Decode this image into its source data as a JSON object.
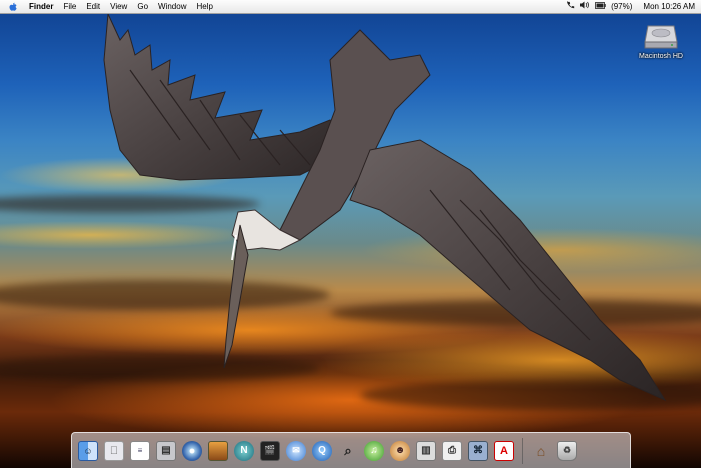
{
  "menubar": {
    "app_name": "Finder",
    "items": [
      "File",
      "Edit",
      "View",
      "Go",
      "Window",
      "Help"
    ],
    "battery": "(97%)",
    "clock": "Mon 10:26 AM"
  },
  "desktop": {
    "hd_label": "Macintosh HD"
  },
  "dock": {
    "items": [
      {
        "name": "finder",
        "icon": "finder-icon"
      },
      {
        "name": "about-mac",
        "icon": "apple-icon"
      },
      {
        "name": "text-edit",
        "icon": "document-icon"
      },
      {
        "name": "printer",
        "icon": "printer-icon"
      },
      {
        "name": "itunes-cd",
        "icon": "cd-icon"
      },
      {
        "name": "iphoto",
        "icon": "photo-icon"
      },
      {
        "name": "internet-connect",
        "icon": "n-icon"
      },
      {
        "name": "imovie",
        "icon": "clapper-icon"
      },
      {
        "name": "mail",
        "icon": "mail-icon"
      },
      {
        "name": "quicktime",
        "icon": "quicktime-icon"
      },
      {
        "name": "sherlock",
        "icon": "magnifier-icon"
      },
      {
        "name": "itunes",
        "icon": "music-icon"
      },
      {
        "name": "ichat",
        "icon": "face-icon"
      },
      {
        "name": "print-center",
        "icon": "print-center-icon"
      },
      {
        "name": "fax",
        "icon": "fax-icon"
      },
      {
        "name": "network",
        "icon": "network-icon"
      },
      {
        "name": "acrobat",
        "icon": "acrobat-icon"
      },
      {
        "name": "home",
        "icon": "home-icon"
      },
      {
        "name": "trash",
        "icon": "trash-icon"
      }
    ]
  },
  "colors": {
    "menu_bg": "#f4f4f4",
    "apple_blue": "#2a6fd8",
    "sky_top": "#0f3f8e",
    "sunset": "#ff9a2a"
  }
}
